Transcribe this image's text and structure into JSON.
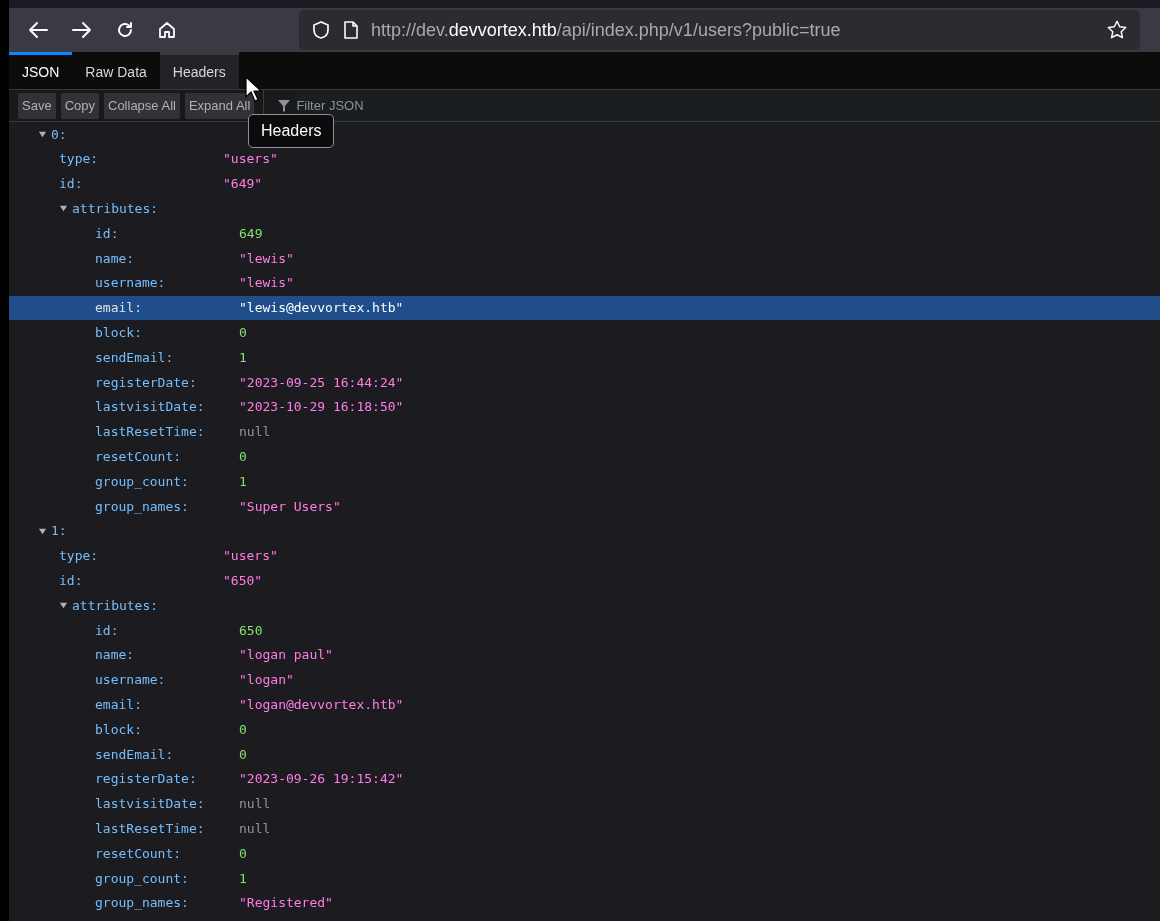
{
  "browser": {
    "url_prefix": "http://dev.",
    "url_host": "devvortex.htb",
    "url_path": "/api/index.php/v1/users?public=true"
  },
  "tabs": [
    {
      "label": "JSON",
      "selected": true,
      "hovered": false
    },
    {
      "label": "Raw Data",
      "selected": false,
      "hovered": false
    },
    {
      "label": "Headers",
      "selected": false,
      "hovered": true
    }
  ],
  "toolbar": {
    "buttons": [
      "Save",
      "Copy",
      "Collapse All",
      "Expand All"
    ],
    "filter_placeholder": "Filter JSON"
  },
  "tooltip": "Headers",
  "tree": [
    {
      "key": "0:",
      "expanded": true,
      "selected": false,
      "children": [
        {
          "key": "type:",
          "value": "\"users\"",
          "kind": "string",
          "selected": false
        },
        {
          "key": "id:",
          "value": "\"649\"",
          "kind": "string",
          "selected": false
        },
        {
          "key": "attributes:",
          "expanded": true,
          "selected": false,
          "children": [
            {
              "key": "id:",
              "value": "649",
              "kind": "number",
              "selected": false
            },
            {
              "key": "name:",
              "value": "\"lewis\"",
              "kind": "string",
              "selected": false
            },
            {
              "key": "username:",
              "value": "\"lewis\"",
              "kind": "string",
              "selected": false
            },
            {
              "key": "email:",
              "value": "\"lewis@devvortex.htb\"",
              "kind": "string",
              "selected": true
            },
            {
              "key": "block:",
              "value": "0",
              "kind": "number",
              "selected": false
            },
            {
              "key": "sendEmail:",
              "value": "1",
              "kind": "number",
              "selected": false
            },
            {
              "key": "registerDate:",
              "value": "\"2023-09-25 16:44:24\"",
              "kind": "string",
              "selected": false
            },
            {
              "key": "lastvisitDate:",
              "value": "\"2023-10-29 16:18:50\"",
              "kind": "string",
              "selected": false
            },
            {
              "key": "lastResetTime:",
              "value": "null",
              "kind": "null",
              "selected": false
            },
            {
              "key": "resetCount:",
              "value": "0",
              "kind": "number",
              "selected": false
            },
            {
              "key": "group_count:",
              "value": "1",
              "kind": "number",
              "selected": false
            },
            {
              "key": "group_names:",
              "value": "\"Super Users\"",
              "kind": "string",
              "selected": false
            }
          ]
        }
      ]
    },
    {
      "key": "1:",
      "expanded": true,
      "selected": false,
      "children": [
        {
          "key": "type:",
          "value": "\"users\"",
          "kind": "string",
          "selected": false
        },
        {
          "key": "id:",
          "value": "\"650\"",
          "kind": "string",
          "selected": false
        },
        {
          "key": "attributes:",
          "expanded": true,
          "selected": false,
          "children": [
            {
              "key": "id:",
              "value": "650",
              "kind": "number",
              "selected": false
            },
            {
              "key": "name:",
              "value": "\"logan paul\"",
              "kind": "string",
              "selected": false
            },
            {
              "key": "username:",
              "value": "\"logan\"",
              "kind": "string",
              "selected": false
            },
            {
              "key": "email:",
              "value": "\"logan@devvortex.htb\"",
              "kind": "string",
              "selected": false
            },
            {
              "key": "block:",
              "value": "0",
              "kind": "number",
              "selected": false
            },
            {
              "key": "sendEmail:",
              "value": "0",
              "kind": "number",
              "selected": false
            },
            {
              "key": "registerDate:",
              "value": "\"2023-09-26 19:15:42\"",
              "kind": "string",
              "selected": false
            },
            {
              "key": "lastvisitDate:",
              "value": "null",
              "kind": "null",
              "selected": false
            },
            {
              "key": "lastResetTime:",
              "value": "null",
              "kind": "null",
              "selected": false
            },
            {
              "key": "resetCount:",
              "value": "0",
              "kind": "number",
              "selected": false
            },
            {
              "key": "group_count:",
              "value": "1",
              "kind": "number",
              "selected": false
            },
            {
              "key": "group_names:",
              "value": "\"Registered\"",
              "kind": "string",
              "selected": false
            }
          ]
        }
      ]
    }
  ]
}
